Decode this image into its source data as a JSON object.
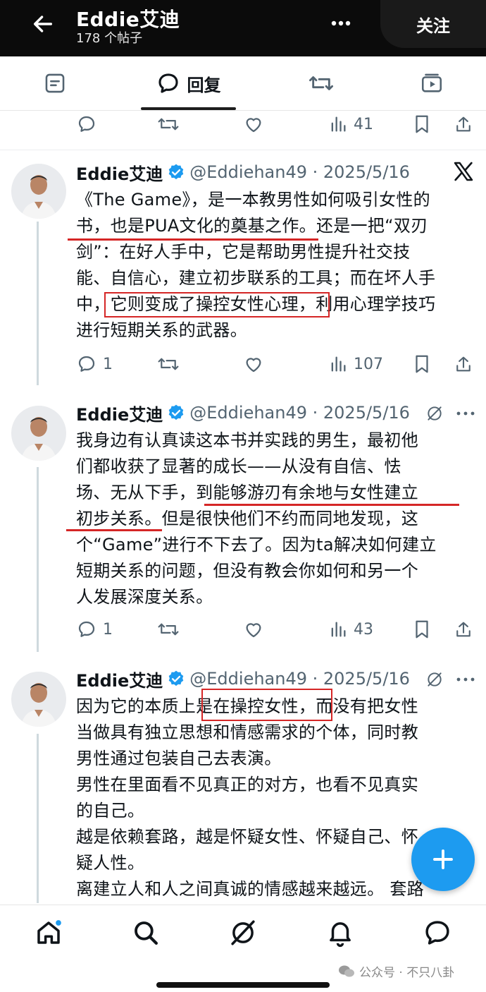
{
  "header": {
    "name": "Eddie艾迪",
    "post_count": "178 个帖子",
    "follow_label": "关注"
  },
  "tabs": [
    {
      "label": ""
    },
    {
      "label": "回复"
    },
    {
      "label": ""
    },
    {
      "label": ""
    }
  ],
  "top_actions": {
    "views": "41"
  },
  "tweets": [
    {
      "name": "Eddie艾迪",
      "handle": "@Eddiehan49 · 2025/5/16",
      "lines": [
        "《The Game》，是一本教男性如何吸引女性的",
        "书，也是PUA文化的奠基之作。还是一把“双刃",
        "剑”：在好人手中，它是帮助男性提升社交技",
        "能、自信心，建立初步联系的工具；而在坏人手",
        "中，它则变成了操控女性心理，利用心理学技巧",
        "进行短期关系的武器。"
      ],
      "replies": "1",
      "views": "107"
    },
    {
      "name": "Eddie艾迪",
      "handle": "@Eddiehan49 · 2025/5/16",
      "lines": [
        "我身边有认真读这本书并实践的男生，最初他",
        "们都收获了显著的成长——从没有自信、怯",
        "场、无从下手，到能够游刃有余地与女性建立",
        "初步关系。但是很快他们不约而同地发现，这",
        "个“Game”进行不下去了。因为ta解决如何建立",
        "短期关系的问题，但没有教会你如何和另一个",
        "人发展深度关系。"
      ],
      "replies": "1",
      "views": "43"
    },
    {
      "name": "Eddie艾迪",
      "handle": "@Eddiehan49 · 2025/5/16",
      "lines": [
        "因为它的本质上是在操控女性，而没有把女性",
        "当做具有独立思想和情感需求的个体，同时教",
        "男性通过包装自己去表演。",
        "男性在里面看不见真正的对方，也看不见真实",
        "的自己。",
        "越是依赖套路，越是怀疑女性、怀疑自己、怀",
        "疑人性。",
        "离建立人和人之间真诚的情感越来越远。 套路"
      ]
    }
  ],
  "watermark": "公众号 · 不只八卦",
  "colors": {
    "accent": "#1d9bf0",
    "highlight": "#d52626",
    "muted": "#536471"
  }
}
